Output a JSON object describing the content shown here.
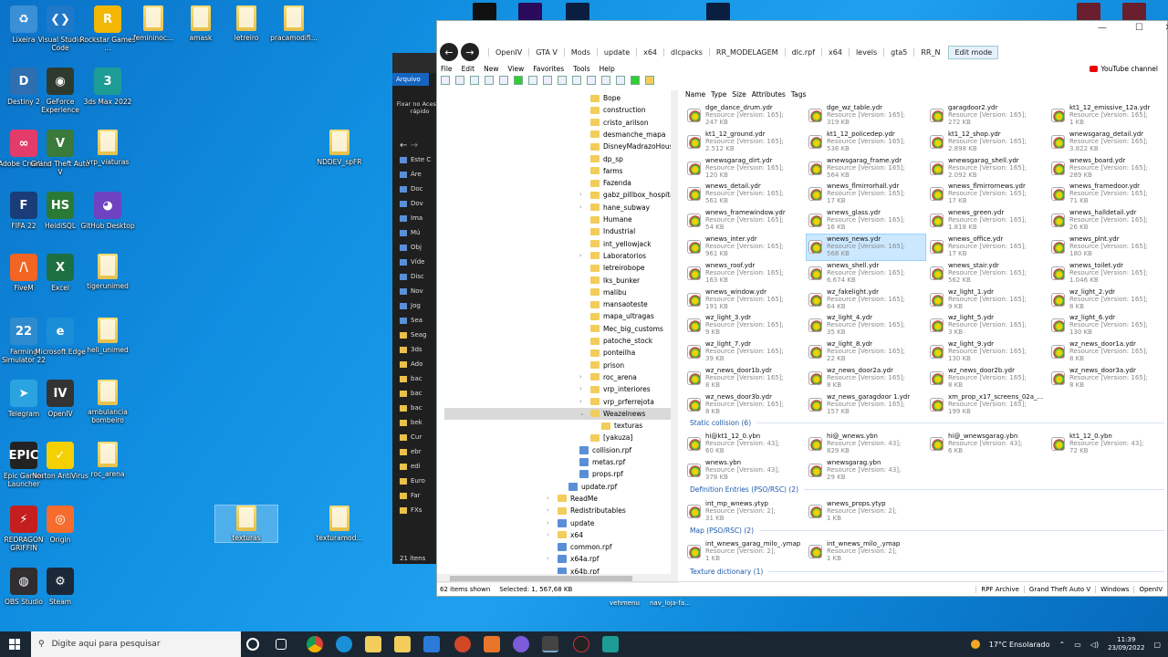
{
  "desktop": {
    "icons": [
      {
        "label": "Lixeira",
        "icon": "recycle-bin-icon",
        "color": "#3a8fd6",
        "glyph": "♻"
      },
      {
        "label": "Visual Studio Code",
        "icon": "vscode-icon",
        "color": "#1f78c8",
        "glyph": "❮❯"
      },
      {
        "label": "Rockstar Games ...",
        "icon": "rockstar-icon",
        "color": "#f2b705",
        "glyph": "R"
      },
      {
        "label": "femininoc...",
        "icon": "folder-icon",
        "color": "",
        "glyph": ""
      },
      {
        "label": "amask",
        "icon": "folder-icon",
        "color": "",
        "glyph": ""
      },
      {
        "label": "letreiro",
        "icon": "folder-icon",
        "color": "",
        "glyph": ""
      },
      {
        "label": "pracamodifi...",
        "icon": "folder-icon",
        "color": "",
        "glyph": ""
      },
      {
        "label": "Destiny 2",
        "icon": "destiny-icon",
        "color": "#2d6fb0",
        "glyph": "D"
      },
      {
        "label": "GeForce Experience",
        "icon": "geforce-icon",
        "color": "#2f3a2f",
        "glyph": "◉"
      },
      {
        "label": "3ds Max 2022",
        "icon": "3dsmax-icon",
        "color": "#1d9c95",
        "glyph": "3"
      },
      {
        "label": "Adobe Creati...",
        "icon": "adobe-cc-icon",
        "color": "#e33b6a",
        "glyph": "∞"
      },
      {
        "label": "Grand Theft Auto V",
        "icon": "gtav-icon",
        "color": "#3a7a3a",
        "glyph": "V"
      },
      {
        "label": "vrp_viaturas",
        "icon": "folder-icon",
        "color": "",
        "glyph": ""
      },
      {
        "label": "NDDEV_spFR",
        "icon": "folder-icon",
        "color": "",
        "glyph": ""
      },
      {
        "label": "FIFA 22",
        "icon": "fifa-icon",
        "color": "#1a3d7a",
        "glyph": "F"
      },
      {
        "label": "HeidiSQL",
        "icon": "heidisql-icon",
        "color": "#2a7a36",
        "glyph": "HS"
      },
      {
        "label": "GitHub Desktop",
        "icon": "github-icon",
        "color": "#6f42c1",
        "glyph": "◕"
      },
      {
        "label": "FiveM",
        "icon": "fivem-icon",
        "color": "#f26522",
        "glyph": "/\\"
      },
      {
        "label": "Excel",
        "icon": "excel-icon",
        "color": "#1d6f42",
        "glyph": "X"
      },
      {
        "label": "tigerunimed",
        "icon": "folder-icon",
        "color": "",
        "glyph": ""
      },
      {
        "label": "Farming Simulator 22",
        "icon": "farming-icon",
        "color": "#2e8bd0",
        "glyph": "22"
      },
      {
        "label": "Microsoft Edge",
        "icon": "edge-icon",
        "color": "#1a8fd8",
        "glyph": "e"
      },
      {
        "label": "heli_unimed",
        "icon": "folder-icon",
        "color": "",
        "glyph": ""
      },
      {
        "label": "Telegram",
        "icon": "telegram-icon",
        "color": "#2aa3e0",
        "glyph": "➤"
      },
      {
        "label": "OpenIV",
        "icon": "openiv-icon",
        "color": "#333333",
        "glyph": "IV"
      },
      {
        "label": "ambulancia bombeiro",
        "icon": "folder-icon",
        "color": "",
        "glyph": ""
      },
      {
        "label": "Epic Games Launcher",
        "icon": "epic-icon",
        "color": "#222222",
        "glyph": "EPIC"
      },
      {
        "label": "Norton AntiVirus",
        "icon": "norton-icon",
        "color": "#f5d000",
        "glyph": "✓"
      },
      {
        "label": "roc_arena",
        "icon": "folder-icon",
        "color": "",
        "glyph": ""
      },
      {
        "label": "texturas",
        "icon": "folder-icon",
        "color": "",
        "glyph": ""
      },
      {
        "label": "texturamod...",
        "icon": "folder-icon",
        "color": "",
        "glyph": ""
      },
      {
        "label": "REDRAGON GRIFFIN",
        "icon": "redragon-icon",
        "color": "#c41e1e",
        "glyph": "⚡"
      },
      {
        "label": "Origin",
        "icon": "origin-icon",
        "color": "#f56c2d",
        "glyph": "◎"
      },
      {
        "label": "OBS Studio",
        "icon": "obs-icon",
        "color": "#302e31",
        "glyph": "◍"
      },
      {
        "label": "Steam",
        "icon": "steam-icon",
        "color": "#1b2838",
        "glyph": "⚙"
      }
    ]
  },
  "dark_explorer": {
    "arquivo_tab": "Arquivo",
    "pin_label": "Fixar no Acesso rápido",
    "items": [
      "Este C",
      "Áre",
      "Doc",
      "Dov",
      "Ima",
      "Mú",
      "Obj",
      "Víde",
      "Disc",
      "Nov",
      "Jog",
      "Sea",
      "Seag",
      "3ds",
      "Ado",
      "bac",
      "bac",
      "bac",
      "bek",
      "Cur",
      "ebr",
      "edi",
      "Euro",
      "Far",
      "FXs"
    ],
    "count": "21 itens"
  },
  "window": {
    "nav": {
      "back": "back",
      "forward": "forward"
    },
    "breadcrumbs": [
      "OpenIV",
      "GTA V",
      "Mods",
      "update",
      "x64",
      "dlcpacks",
      "RR_MODELAGEM",
      "dlc.rpf",
      "x64",
      "levels",
      "gta5",
      "RR_N"
    ],
    "edit_mode": "Edit mode",
    "menu": [
      "File",
      "Edit",
      "New",
      "View",
      "Favorites",
      "Tools",
      "Help"
    ],
    "youtube": "YouTube channel",
    "columns": [
      "Name",
      "Type",
      "Size",
      "Attributes",
      "Tags"
    ],
    "tree": [
      {
        "label": "Bope",
        "kind": "folder",
        "arrow": ""
      },
      {
        "label": "construction",
        "kind": "folder",
        "arrow": ""
      },
      {
        "label": "cristo_arilson",
        "kind": "folder",
        "arrow": ""
      },
      {
        "label": "desmanche_mapa",
        "kind": "folder",
        "arrow": ""
      },
      {
        "label": "DisneyMadrazoHouse",
        "kind": "folder",
        "arrow": ""
      },
      {
        "label": "dp_sp",
        "kind": "folder",
        "arrow": ""
      },
      {
        "label": "farms",
        "kind": "folder",
        "arrow": ""
      },
      {
        "label": "Fazenda",
        "kind": "folder",
        "arrow": ""
      },
      {
        "label": "gabz_pillbox_hospital_v",
        "kind": "folder",
        "arrow": "›"
      },
      {
        "label": "hane_subway",
        "kind": "folder",
        "arrow": "›"
      },
      {
        "label": "Humane",
        "kind": "folder",
        "arrow": ""
      },
      {
        "label": "Industrial",
        "kind": "folder",
        "arrow": ""
      },
      {
        "label": "int_yellowjack",
        "kind": "folder",
        "arrow": ""
      },
      {
        "label": "Laboratorios",
        "kind": "folder",
        "arrow": "›"
      },
      {
        "label": "letreirobope",
        "kind": "folder",
        "arrow": ""
      },
      {
        "label": "lks_bunker",
        "kind": "folder",
        "arrow": ""
      },
      {
        "label": "malibu",
        "kind": "folder",
        "arrow": ""
      },
      {
        "label": "mansaoteste",
        "kind": "folder",
        "arrow": ""
      },
      {
        "label": "mapa_ultragas",
        "kind": "folder",
        "arrow": ""
      },
      {
        "label": "Mec_big_customs",
        "kind": "folder",
        "arrow": ""
      },
      {
        "label": "patoche_stock",
        "kind": "folder",
        "arrow": ""
      },
      {
        "label": "ponteilha",
        "kind": "folder",
        "arrow": ""
      },
      {
        "label": "prison",
        "kind": "folder",
        "arrow": ""
      },
      {
        "label": "roc_arena",
        "kind": "folder",
        "arrow": "›"
      },
      {
        "label": "vrp_interiores",
        "kind": "folder",
        "arrow": "›"
      },
      {
        "label": "vrp_prferrejota",
        "kind": "folder",
        "arrow": "›"
      },
      {
        "label": "Weazelnews",
        "kind": "folder",
        "arrow": "⌄",
        "selected": true
      },
      {
        "label": "texturas",
        "kind": "folder",
        "arrow": "",
        "indent": 1
      },
      {
        "label": "[yakuza]",
        "kind": "folder",
        "arrow": ""
      },
      {
        "label": "collision.rpf",
        "kind": "rpf",
        "arrow": "",
        "indent": -1
      },
      {
        "label": "metas.rpf",
        "kind": "rpf",
        "arrow": "",
        "indent": -1
      },
      {
        "label": "props.rpf",
        "kind": "rpf",
        "arrow": "",
        "indent": -1
      },
      {
        "label": "update.rpf",
        "kind": "rpf",
        "arrow": "",
        "indent": -2
      },
      {
        "label": "ReadMe",
        "kind": "folder",
        "arrow": "›",
        "indent": -3
      },
      {
        "label": "Redistributables",
        "kind": "folder",
        "arrow": "›",
        "indent": -3
      },
      {
        "label": "update",
        "kind": "rpf",
        "arrow": "›",
        "indent": -3
      },
      {
        "label": "x64",
        "kind": "folder",
        "arrow": "›",
        "indent": -3
      },
      {
        "label": "common.rpf",
        "kind": "rpf",
        "arrow": "",
        "indent": -3
      },
      {
        "label": "x64a.rpf",
        "kind": "rpf",
        "arrow": "›",
        "indent": -3
      },
      {
        "label": "x64b.rpf",
        "kind": "rpf",
        "arrow": "",
        "indent": -3
      }
    ],
    "drawables": [
      [
        "dge_dance_drum.ydr",
        "247 KB"
      ],
      [
        "dge_wz_table.ydr",
        "319 KB"
      ],
      [
        "garagdoor2.ydr",
        "272 KB"
      ],
      [
        "kt1_12_emissive_12a.ydr",
        "1 KB"
      ],
      [
        "kt1_12_ground.ydr",
        "2.512 KB"
      ],
      [
        "kt1_12_policedep.ydr",
        "536 KB"
      ],
      [
        "kt1_12_shop.ydr",
        "2.898 KB"
      ],
      [
        "wnewsgarag_detail.ydr",
        "3.822 KB"
      ],
      [
        "wnewsgarag_dirt.ydr",
        "120 KB"
      ],
      [
        "wnewsgarag_frame.ydr",
        "564 KB"
      ],
      [
        "wnewsgarag_shell.ydr",
        "2.092 KB"
      ],
      [
        "wnews_board.ydr",
        "289 KB"
      ],
      [
        "wnews_detail.ydr",
        "561 KB"
      ],
      [
        "wnews_flmirrorhall.ydr",
        "17 KB"
      ],
      [
        "wnews_flmirrornews.ydr",
        "17 KB"
      ],
      [
        "wnews_framedoor.ydr",
        "71 KB"
      ],
      [
        "wnews_framewindow.ydr",
        "54 KB"
      ],
      [
        "wnews_glass.ydr",
        "16 KB"
      ],
      [
        "wnews_green.ydr",
        "1.818 KB"
      ],
      [
        "wnews_halldetail.ydr",
        "26 KB"
      ],
      [
        "wnews_inter.ydr",
        "961 KB"
      ],
      [
        "wnews_news.ydr",
        "568 KB"
      ],
      [
        "wnews_office.ydr",
        "17 KB"
      ],
      [
        "wnews_plnt.ydr",
        "180 KB"
      ],
      [
        "wnews_roof.ydr",
        "163 KB"
      ],
      [
        "wnews_shell.ydr",
        "6.674 KB"
      ],
      [
        "wnews_stair.ydr",
        "562 KB"
      ],
      [
        "wnews_toilet.ydr",
        "1.046 KB"
      ],
      [
        "wnews_window.ydr",
        "191 KB"
      ],
      [
        "wz_fakelight.ydr",
        "64 KB"
      ],
      [
        "wz_light_1.ydr",
        "9 KB"
      ],
      [
        "wz_light_2.ydr",
        "8 KB"
      ],
      [
        "wz_light_3.ydr",
        "9 KB"
      ],
      [
        "wz_light_4.ydr",
        "35 KB"
      ],
      [
        "wz_light_5.ydr",
        "3 KB"
      ],
      [
        "wz_light_6.ydr",
        "130 KB"
      ],
      [
        "wz_light_7.ydr",
        "39 KB"
      ],
      [
        "wz_light_8.ydr",
        "22 KB"
      ],
      [
        "wz_light_9.ydr",
        "130 KB"
      ],
      [
        "wz_news_door1a.ydr",
        "8 KB"
      ],
      [
        "wz_news_door1b.ydr",
        "8 KB"
      ],
      [
        "wz_news_door2a.ydr",
        "8 KB"
      ],
      [
        "wz_news_door2b.ydr",
        "8 KB"
      ],
      [
        "wz_news_door3a.ydr",
        "8 KB"
      ],
      [
        "wz_news_door3b.ydr",
        "8 KB"
      ],
      [
        "wz_news_garagdoor 1.ydr",
        "157 KB"
      ],
      [
        "xm_prop_x17_screens_02a_...",
        "199 KB"
      ]
    ],
    "drawable_desc": "Resource [Version: 165];",
    "selected_file": "wnews_news.ydr",
    "groups": {
      "static": "Static collision (6)",
      "defs": "Definition Entries (PSO/RSC) (2)",
      "map": "Map (PSO/RSC) (2)",
      "tex": "Texture dictionary (1)"
    },
    "collisions": [
      [
        "hi@kt1_12_0.ybn",
        "60 KB"
      ],
      [
        "hi@_wnews.ybn",
        "829 KB"
      ],
      [
        "hi@_wnewsgarag.ybn",
        "6 KB"
      ],
      [
        "kt1_12_0.ybn",
        "72 KB"
      ],
      [
        "wnews.ybn",
        "378 KB"
      ],
      [
        "wnewsgarag.ybn",
        "29 KB"
      ]
    ],
    "collision_desc": "Resource [Version: 43];",
    "defs": [
      [
        "int_mp_wnews.ytyp",
        "31 KB"
      ],
      [
        "wnews_props.ytyp",
        "1 KB"
      ]
    ],
    "maps": [
      [
        "int_wnews_garag_milo_.ymap",
        "1 KB"
      ],
      [
        "int_wnews_milo_.ymap",
        "1 KB"
      ]
    ],
    "rsc2_desc": "Resource [Version: 2];",
    "status": {
      "count": "62 items shown",
      "selected": "Selected: 1,  567,68 KB",
      "archive": "RPF Archive",
      "game": "Grand Theft Auto V",
      "os": "Windows",
      "app": "OpenIV"
    }
  },
  "desktop_bottom": {
    "l1": "vehmenu",
    "l2": "nav_loja-fa..."
  },
  "taskbar": {
    "search_placeholder": "Digite aqui para pesquisar",
    "weather": "17°C  Ensolarado",
    "time": "11:39",
    "date": "23/09/2022"
  }
}
